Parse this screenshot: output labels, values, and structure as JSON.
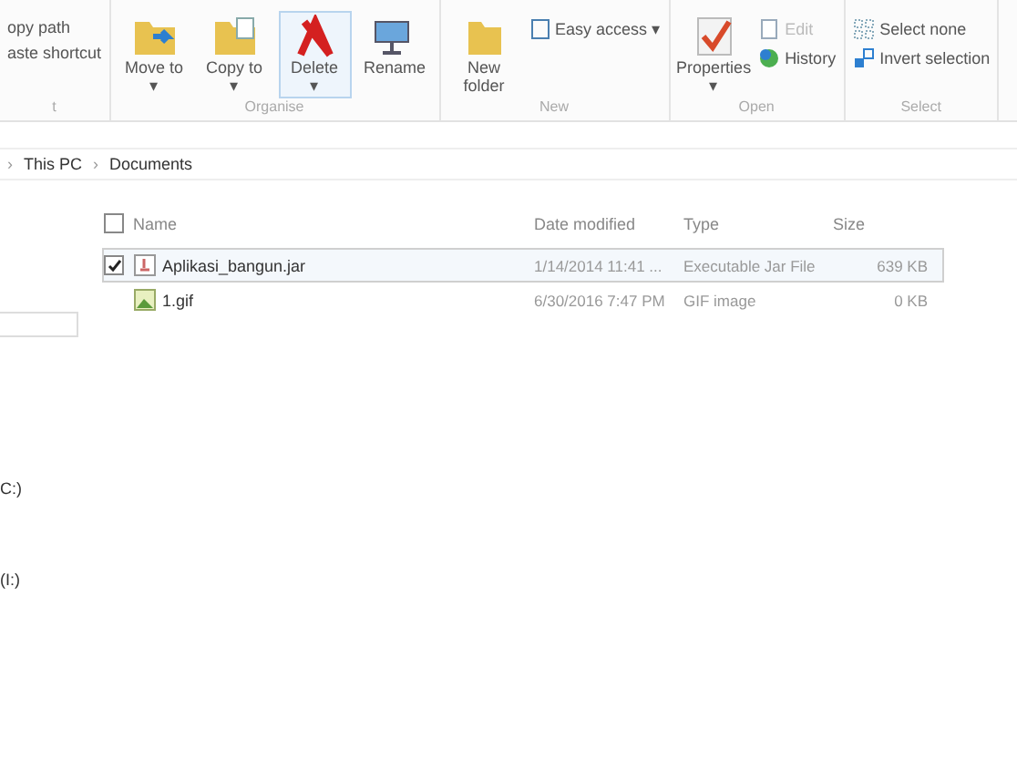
{
  "ribbon": {
    "groups": [
      {
        "kind": "list",
        "label": "t",
        "items": [
          {
            "label": "opy path",
            "kind": "none"
          },
          {
            "label": "aste shortcut",
            "kind": "none"
          }
        ]
      },
      {
        "kind": "big",
        "label": "Organise",
        "items": [
          {
            "label": "Move to ▾",
            "kind": "move"
          },
          {
            "label": "Copy to ▾",
            "kind": "copy"
          },
          {
            "label": "Delete ▾",
            "kind": "delete",
            "selected": true
          },
          {
            "label": "Rename",
            "kind": "rename",
            "selected": false
          }
        ]
      },
      {
        "kind": "mixed",
        "label": "New",
        "items": [
          {
            "label": "New folder",
            "kind": "folder"
          },
          {
            "label": "Easy access ▾",
            "kind": "easy"
          }
        ]
      },
      {
        "kind": "mixed",
        "label": "Open",
        "items": [
          {
            "label": "Properties ▾",
            "kind": "properties"
          },
          {
            "label": "Edit",
            "kind": "edit",
            "disabled": true
          },
          {
            "label": "History",
            "kind": "history",
            "disabled": false
          }
        ]
      },
      {
        "kind": "list",
        "label": "Select",
        "items": [
          {
            "label": "Select none",
            "kind": "selnone"
          },
          {
            "label": "Invert selection",
            "kind": "invert"
          }
        ]
      }
    ]
  },
  "breadcrumb": [
    {
      "separator": "›",
      "label": "This PC"
    },
    {
      "separator": "›",
      "label": "Documents"
    }
  ],
  "nav": [
    "C:)",
    "(I:)"
  ],
  "table": {
    "select_all_checked": false,
    "columns": [
      "Name",
      "Date modified",
      "Type",
      "Size"
    ],
    "rows": [
      {
        "name": "Aplikasi_bangun.jar",
        "date": "1/14/2014 11:41 ...",
        "type": "Executable Jar File",
        "size": "639 KB",
        "selected": true,
        "checked": true,
        "kind": "jar"
      },
      {
        "name": "1.gif",
        "date": "6/30/2016 7:47 PM",
        "type": "GIF image",
        "size": "0 KB",
        "selected": false,
        "checked": false,
        "kind": "gif"
      }
    ]
  }
}
